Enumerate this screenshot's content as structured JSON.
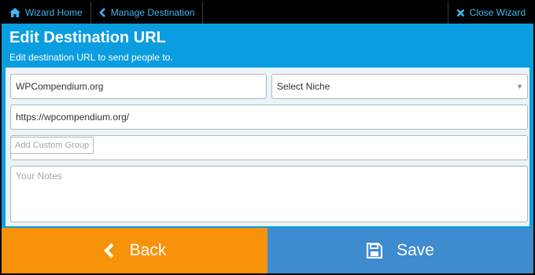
{
  "nav": {
    "home_label": "Wizard Home",
    "manage_label": "Manage Destination",
    "close_label": "Close Wizard"
  },
  "header": {
    "title": "Edit Destination URL",
    "subtitle": "Edit destination URL to send people to."
  },
  "form": {
    "name_value": "WPCompendium.org",
    "niche_value": "Select Niche",
    "url_value": "https://wpcompendium.org/",
    "group_button_label": "Add Custom Group",
    "notes_placeholder": "Your Notes"
  },
  "actions": {
    "back_label": "Back",
    "save_label": "Save"
  },
  "colors": {
    "accent": "#0a9de0",
    "nav_text": "#3fb6f5",
    "back": "#f8920a",
    "save": "#3e8bd0"
  },
  "icons": {
    "home": "home-icon",
    "manage": "chevron-left-icon",
    "close": "close-icon",
    "back": "chevron-left-icon",
    "save": "floppy-disk-icon"
  }
}
